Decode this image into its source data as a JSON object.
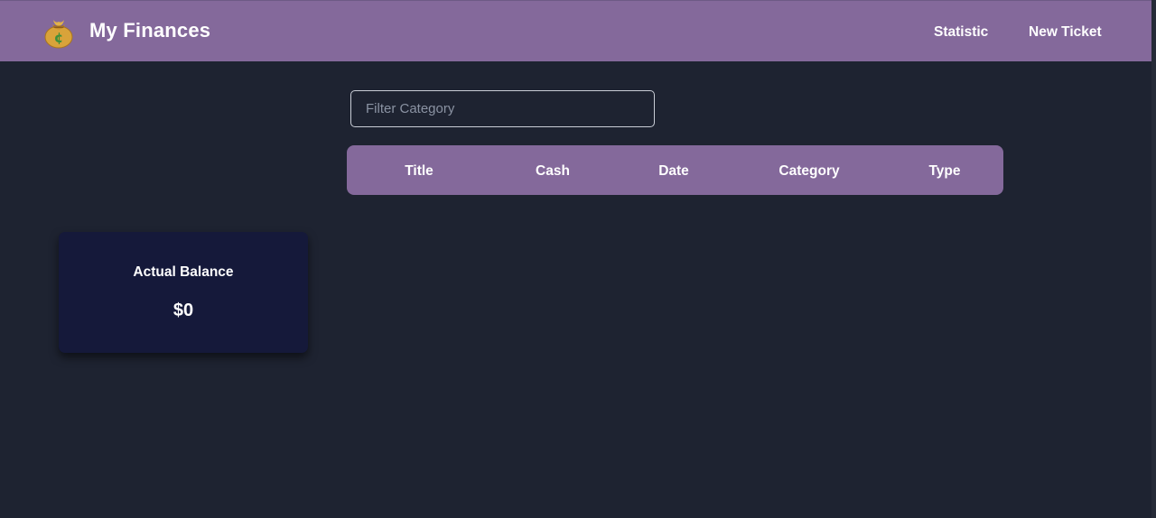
{
  "header": {
    "logo_icon": "money-bag-icon",
    "brand": "My Finances",
    "nav": {
      "statistic": "Statistic",
      "new_ticket": "New Ticket"
    },
    "color": "#84699b"
  },
  "filter": {
    "placeholder": "Filter Category",
    "value": ""
  },
  "table": {
    "columns": [
      "Title",
      "Cash",
      "Date",
      "Category",
      "Type"
    ],
    "rows": []
  },
  "balance": {
    "label": "Actual Balance",
    "value": "$0"
  },
  "colors": {
    "background": "#1e2331",
    "accent": "#84699b",
    "card": "#15193a"
  }
}
